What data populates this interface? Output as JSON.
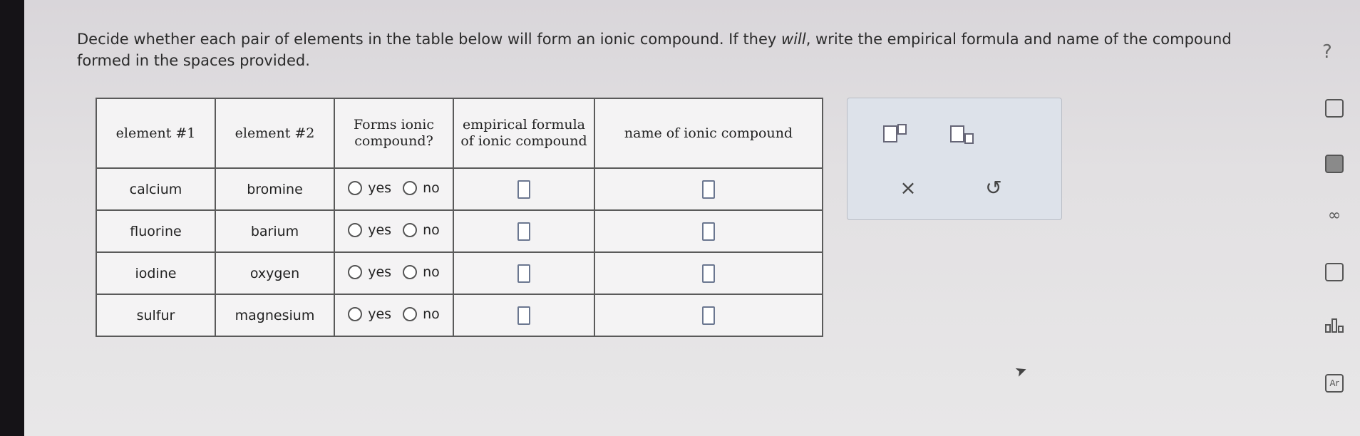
{
  "question": {
    "part1": "Decide whether each pair of elements in the table below will form an ionic compound. If they ",
    "emphasis": "will",
    "part2": ", write the empirical formula and name of the compound formed in the spaces provided."
  },
  "table": {
    "headers": {
      "element1": "element #1",
      "element2": "element #2",
      "forms_ionic": "Forms ionic compound?",
      "formula": "empirical formula of ionic compound",
      "name": "name of ionic compound"
    },
    "radio_yes": "yes",
    "radio_no": "no",
    "rows": [
      {
        "el1": "calcium",
        "el2": "bromine"
      },
      {
        "el1": "fluorine",
        "el2": "barium"
      },
      {
        "el1": "iodine",
        "el2": "oxygen"
      },
      {
        "el1": "sulfur",
        "el2": "magnesium"
      }
    ]
  },
  "palette": {
    "clear_symbol": "×",
    "undo_symbol": "↺"
  },
  "sidebar": {
    "help_symbol": "?",
    "icons": [
      "periodic-table-icon",
      "calculator-icon",
      "infinity-icon",
      "notes-icon",
      "bar-chart-icon",
      "text-size-icon"
    ],
    "infinity_symbol": "∞",
    "text_size_symbol": "Ar"
  }
}
